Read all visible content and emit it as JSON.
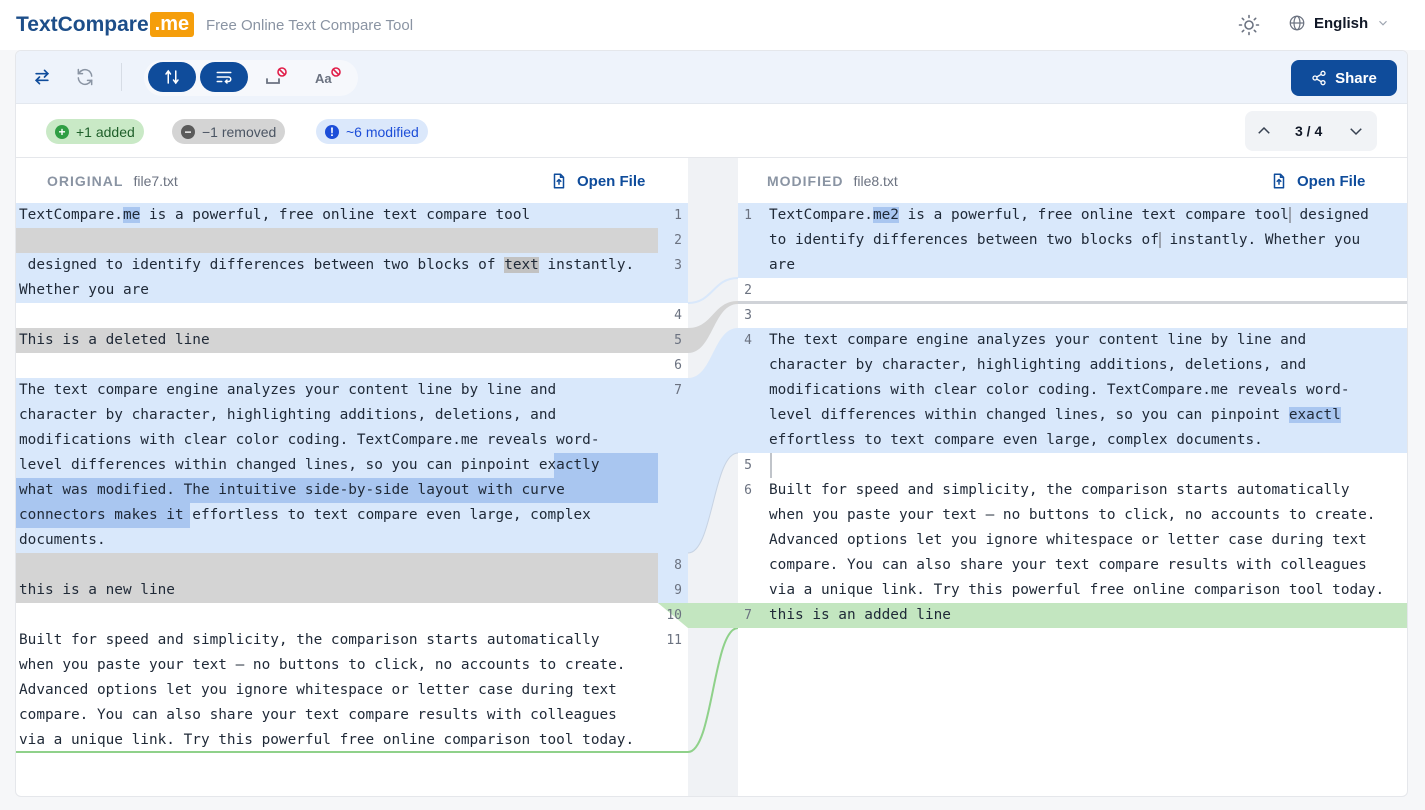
{
  "app": {
    "logo_main": "TextCompare",
    "logo_suffix": ".me",
    "tagline": "Free Online Text Compare Tool",
    "language": "English"
  },
  "toolbar": {
    "share_label": "Share",
    "icons": [
      "swap-icon",
      "refresh-icon",
      "ignore-line-order-icon",
      "word-wrap-icon",
      "ignore-whitespace-icon",
      "ignore-case-icon"
    ]
  },
  "stats": {
    "added": "+1 added",
    "removed": "−1 removed",
    "modified": "~6 modified",
    "counter": "3 / 4"
  },
  "left": {
    "label": "ORIGINAL",
    "file": "file7.txt",
    "open_label": "Open File",
    "line_numbers": [
      "1",
      "2",
      "3",
      "4",
      "5",
      "6",
      "7",
      "8",
      "9",
      "10",
      "11"
    ]
  },
  "right": {
    "label": "MODIFIED",
    "file": "file8.txt",
    "open_label": "Open File",
    "line_numbers": [
      "1",
      "2",
      "3",
      "4",
      "5",
      "6",
      "7"
    ]
  },
  "colors": {
    "accent": "#0f4c9b",
    "modified_bg": "#d9e8fb",
    "modified_highlight": "#a9c6f0",
    "removed_bg": "#d4d4d4",
    "added_bg": "#c3e6c0",
    "logo_badge": "#f59e0b"
  },
  "text": {
    "l1a": "TextCompare.",
    "l1b": "me",
    "l1c": " is a powerful, free online text compare tool",
    "l3a": " designed to identify differences between two blocks of ",
    "l3b": "text",
    "l3c": " instantly.",
    "l3d": "Whether you are",
    "l5": "This is a deleted line",
    "l7a": "The text compare engine analyzes your content line by line and",
    "l7b": "character by character, highlighting additions, deletions, and",
    "l7c": "modifications with clear color coding. TextCompare.me reveals word-",
    "l7d1": "level differences within changed lines, so you can pinpoint ",
    "l7d2": "exactly",
    "l7e": "what was modified. The intuitive side-by-side layout with curve",
    "l7f1": "connectors makes it",
    "l7f2": " effortless to text compare even large, complex",
    "l7g": "documents.",
    "l9": "this is a new line",
    "l11a": "Built for speed and simplicity, the comparison starts automatically",
    "l11b": "when you paste your text — no buttons to click, no accounts to create.",
    "l11c": "Advanced options let you ignore whitespace or letter case during text",
    "l11d": "compare. You can also share your text compare results with colleagues",
    "l11e": "via a unique link. Try this powerful free online comparison tool today.",
    "r1a": "TextCompare.",
    "r1b": "me2",
    "r1c": " is a powerful, free online text compare tool",
    "r1d": " designed",
    "r1e": "to identify differences between two blocks of",
    "r1f": " instantly. Whether you",
    "r1g": "are",
    "r4a": "The text compare engine analyzes your content line by line and",
    "r4b": "character by character, highlighting additions, deletions, and",
    "r4c": "modifications with clear color coding. TextCompare.me reveals word-",
    "r4d1": "level differences within changed lines, so you can pinpoint ",
    "r4d2": "exactl",
    "r4e": "effortless to text compare even large, complex documents.",
    "r6a": "Built for speed and simplicity, the comparison starts automatically",
    "r6b": "when you paste your text — no buttons to click, no accounts to create.",
    "r6c": "Advanced options let you ignore whitespace or letter case during text",
    "r6d": "compare. You can also share your text compare results with colleagues",
    "r6e": "via a unique link. Try this powerful free online comparison tool today.",
    "r7": "this is an added line"
  }
}
